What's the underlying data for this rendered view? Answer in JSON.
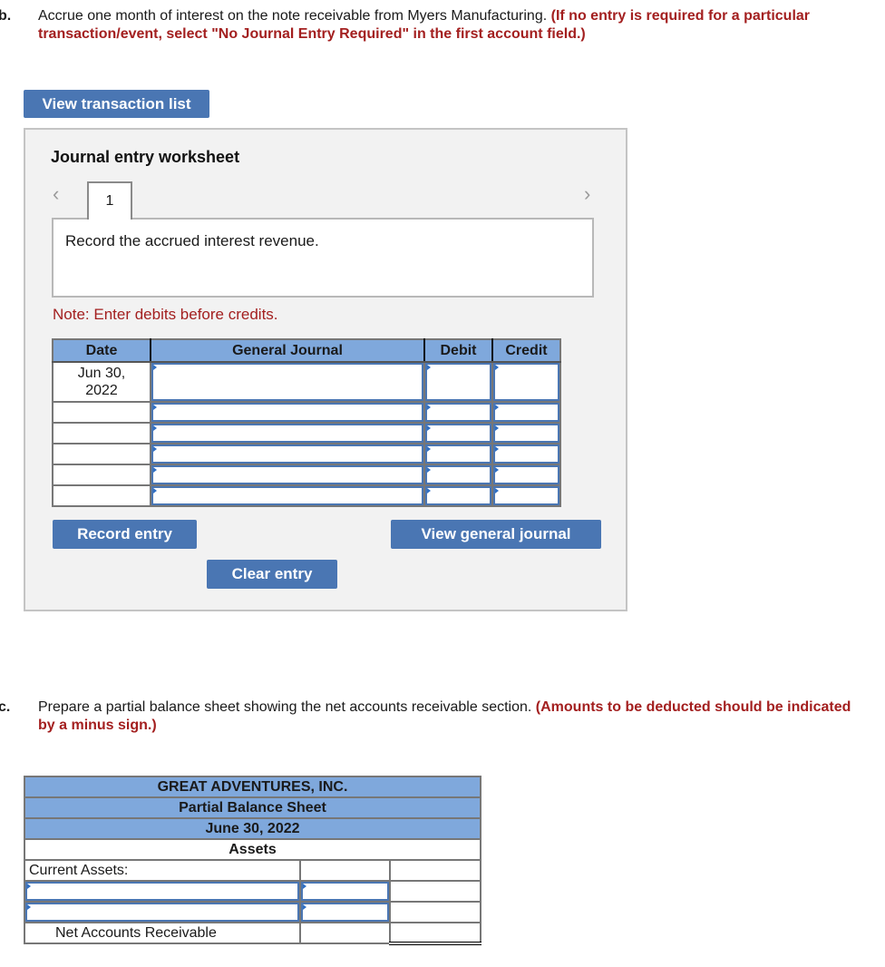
{
  "part_b": {
    "letter": "b.",
    "instruction": "Accrue one month of interest on the note receivable from Myers Manufacturing.",
    "hint": "(If no entry is required for a particular transaction/event, select \"No Journal Entry Required\" in the first account field.)"
  },
  "buttons": {
    "view_transaction_list": "View transaction list",
    "record_entry": "Record entry",
    "clear_entry": "Clear entry",
    "view_general_journal": "View general journal"
  },
  "worksheet": {
    "title": "Journal entry worksheet",
    "prev_icon": "‹",
    "next_icon": "›",
    "current_tab": "1",
    "description": "Record the accrued interest revenue.",
    "note": "Note: Enter debits before credits.",
    "columns": [
      "Date",
      "General Journal",
      "Debit",
      "Credit"
    ],
    "rows": [
      {
        "date": "Jun 30, 2022",
        "account": "",
        "debit": "",
        "credit": ""
      },
      {
        "date": "",
        "account": "",
        "debit": "",
        "credit": ""
      },
      {
        "date": "",
        "account": "",
        "debit": "",
        "credit": ""
      },
      {
        "date": "",
        "account": "",
        "debit": "",
        "credit": ""
      },
      {
        "date": "",
        "account": "",
        "debit": "",
        "credit": ""
      },
      {
        "date": "",
        "account": "",
        "debit": "",
        "credit": ""
      }
    ]
  },
  "part_c": {
    "letter": "c.",
    "instruction": "Prepare a partial balance sheet showing the net accounts receivable section.",
    "hint": "(Amounts to be deducted should be indicated by a minus sign.)"
  },
  "balance_sheet": {
    "company": "GREAT ADVENTURES, INC.",
    "title": "Partial Balance Sheet",
    "date": "June 30, 2022",
    "section": "Assets",
    "current_assets_label": "Current Assets:",
    "input_rows": [
      {
        "account": "",
        "amount": ""
      },
      {
        "account": "",
        "amount": ""
      }
    ],
    "net_label": "Net Accounts Receivable",
    "net_amount": ""
  },
  "colors": {
    "button_blue": "#4a76b3",
    "header_blue": "#7fa8dc",
    "hint_red": "#a31f1f",
    "panel_gray": "#f2f2f2"
  }
}
